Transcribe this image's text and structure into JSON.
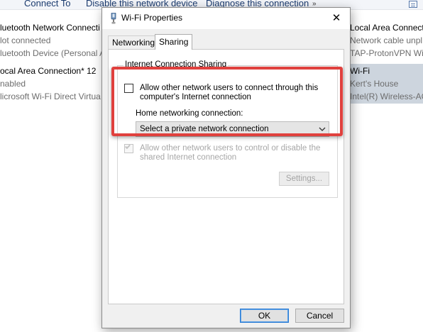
{
  "toolbar": {
    "connect_to": "Connect To",
    "disable_device": "Disable this network device",
    "diagnose": "Diagnose this connection",
    "chevron": "»"
  },
  "background_connections": {
    "left": [
      {
        "name": "luetooth Network Connecti",
        "status": "lot connected",
        "device": "luetooth Device (Personal A"
      },
      {
        "name": "ocal Area Connection* 12",
        "status": "nabled",
        "device": "licrosoft Wi-Fi Direct Virtua"
      }
    ],
    "right": [
      {
        "name": "Local Area Connection",
        "status": "Network cable unpl",
        "device": "TAP-ProtonVPN Wi"
      },
      {
        "name": "Wi-Fi",
        "status": "Kert's House",
        "device": "Intel(R) Wireless-AC"
      }
    ]
  },
  "dialog": {
    "title": "Wi-Fi Properties",
    "close": "✕",
    "tabs": [
      {
        "label": "Networking",
        "active": false
      },
      {
        "label": "Sharing",
        "active": true
      }
    ],
    "group_label": "Internet Connection Sharing",
    "allow_connect": {
      "line1": "Allow other network users to connect through this",
      "line2": "computer's Internet connection",
      "checked": false
    },
    "home_networking_label": "Home networking connection:",
    "home_networking_select": "Select a private network connection",
    "allow_control": {
      "line1": "Allow other network users to control or disable the",
      "line2": "shared Internet connection",
      "checked": true,
      "disabled": true
    },
    "settings_button": "Settings...",
    "ok_button": "OK",
    "cancel_button": "Cancel"
  },
  "colors": {
    "highlight": "#e0413e",
    "default_button_border": "#2a7bd4",
    "selected_item_bg": "#cdd5de"
  }
}
